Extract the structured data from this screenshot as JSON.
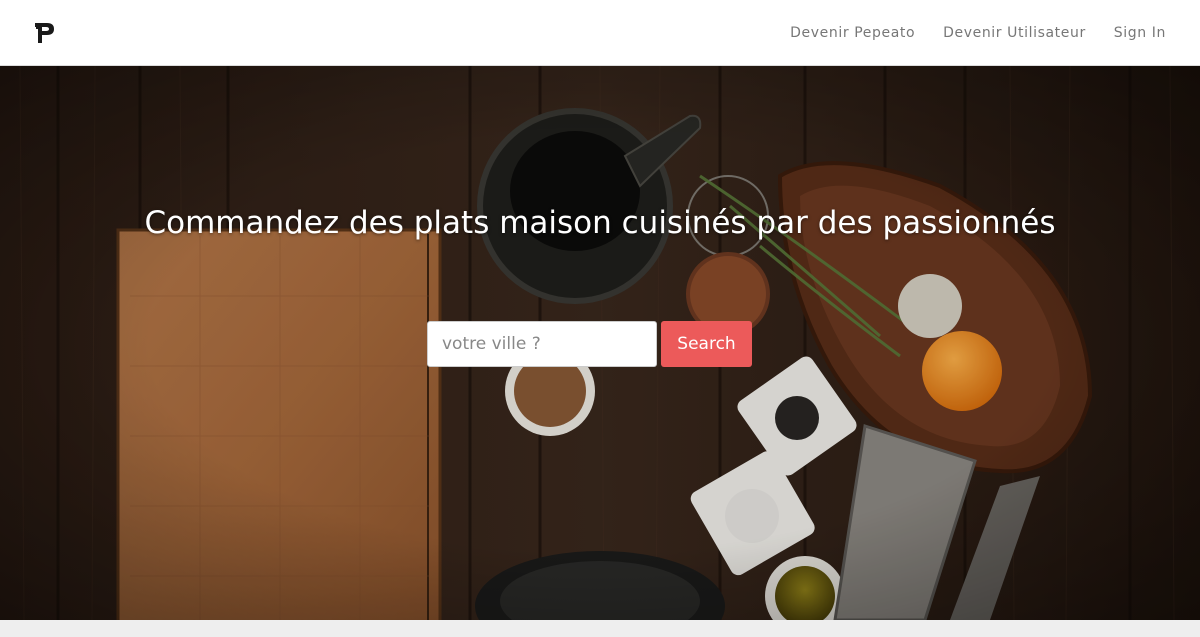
{
  "navbar": {
    "logo_letter": "P",
    "links": [
      {
        "label": "Devenir Pepeato"
      },
      {
        "label": "Devenir Utilisateur"
      },
      {
        "label": "Sign In"
      }
    ]
  },
  "hero": {
    "headline": "Commandez des plats maison cuisinés par des passionnés",
    "search": {
      "placeholder": "votre ville ?",
      "value": "",
      "button_label": "Search"
    }
  },
  "colors": {
    "accent": "#ec5a5a",
    "nav_text": "#777777",
    "hero_text": "#ffffff"
  }
}
